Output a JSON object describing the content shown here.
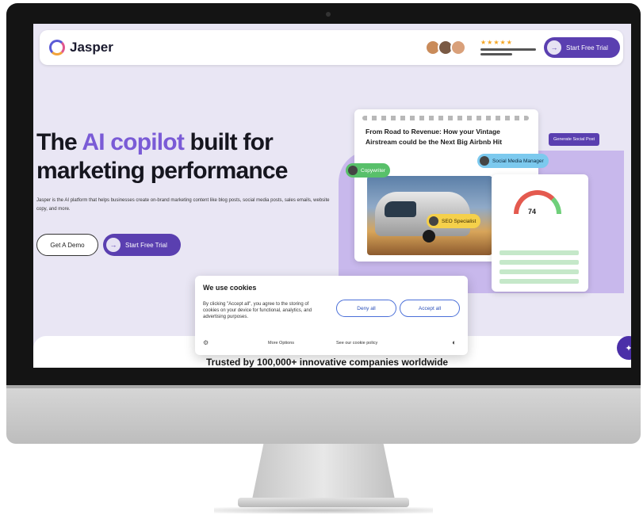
{
  "brand": {
    "name": "Jasper",
    "accent": "#7a5bd6",
    "primary_button": "#5a3fb0"
  },
  "nav": {
    "rating_stars": "★★★★★",
    "cta_label": "Start Free Trial"
  },
  "hero": {
    "headline_part1": "The ",
    "headline_accent": "AI copilot",
    "headline_part2": " built for marketing performance",
    "subtext": "Jasper is the AI platform that helps businesses create on-brand marketing content like blog posts, social media posts, sales emails, website copy, and more.",
    "demo_button": "Get A Demo",
    "trial_button": "Start Free Trial"
  },
  "visual": {
    "card_title": "From Road to Revenue: How your Vintage Airstream could be the Next Big Airbnb Hit",
    "tags": {
      "green": "Copywriter",
      "blue": "Social Media Manager",
      "yellow": "SEO Specialist",
      "purple": "Generate Social Post"
    },
    "gauge_value": "74"
  },
  "cookie": {
    "title": "We use cookies",
    "text": "By clicking \"Accept all\", you agree to the storing of cookies on your device for functional, analytics, and advertising purposes.",
    "deny_label": "Deny all",
    "accept_label": "Accept all",
    "prefs_link": "More Options",
    "policy_link": "See our cookie policy"
  },
  "trusted_text": "Trusted by 100,000+ innovative companies worldwide"
}
